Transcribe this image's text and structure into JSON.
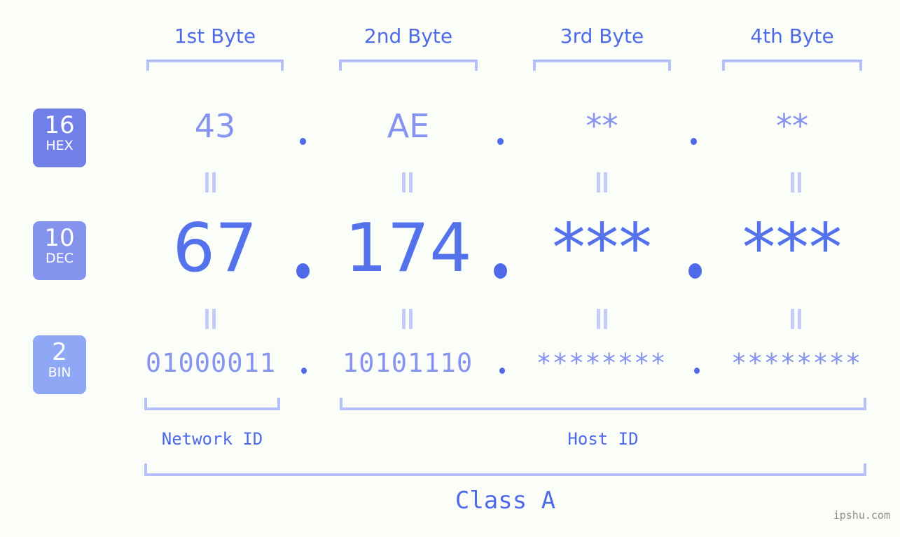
{
  "background_color": "#fbfdf8",
  "accent_colors": {
    "bracket": "#b6c0fb",
    "dot": "#4f6ae8",
    "hex_text": "#8693f0",
    "dec_text": "#5472ec",
    "bin_text": "#8693f0",
    "header_text": "#4f6ae8",
    "badge_hex": "#7180e8",
    "badge_dec": "#8493ee",
    "badge_bin": "#8fa8f5",
    "equals_connector": "#c3cbfb",
    "watermark": "#8d8d8d"
  },
  "headers": [
    {
      "label": "1st Byte"
    },
    {
      "label": "2nd Byte"
    },
    {
      "label": "3rd Byte"
    },
    {
      "label": "4th Byte"
    }
  ],
  "rows": [
    {
      "badge_number": "16",
      "badge_abbr": "HEX",
      "values": [
        "43",
        "AE",
        "**",
        "**"
      ],
      "separator": "."
    },
    {
      "badge_number": "10",
      "badge_abbr": "DEC",
      "values": [
        "67",
        "174",
        "***",
        "***"
      ],
      "separator": "."
    },
    {
      "badge_number": "2",
      "badge_abbr": "BIN",
      "values": [
        "01000011",
        "10101110",
        "********",
        "********"
      ],
      "separator": "."
    }
  ],
  "connectors": {
    "symbol": "||",
    "meaning": "equals"
  },
  "id_sections": [
    {
      "label": "Network ID"
    },
    {
      "label": "Host ID"
    }
  ],
  "class_label": "Class A",
  "watermark": "ipshu.com"
}
